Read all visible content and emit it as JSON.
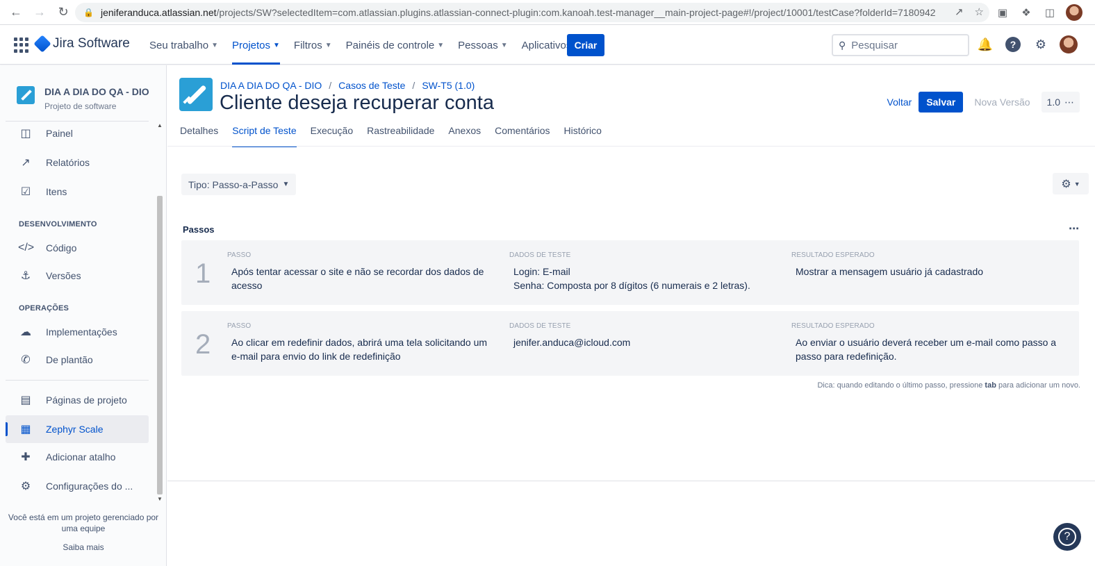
{
  "browser": {
    "url_host": "jeniferanduca.atlassian.net",
    "url_path": "/projects/SW?selectedItem=com.atlassian.plugins.atlassian-connect-plugin:com.kanoah.test-manager__main-project-page#!/project/10001/testCase?folderId=7180942"
  },
  "topnav": {
    "brand": "Jira Software",
    "menu": [
      "Seu trabalho",
      "Projetos",
      "Filtros",
      "Painéis de controle",
      "Pessoas",
      "Aplicativos"
    ],
    "create_label": "Criar",
    "search_placeholder": "Pesquisar"
  },
  "sidebar": {
    "project_name": "DIA A DIA DO QA - DIO",
    "project_type": "Projeto de software",
    "items": [
      "Painel",
      "Relatórios",
      "Itens"
    ],
    "section_dev": "DESENVOLVIMENTO",
    "dev_items": [
      "Código",
      "Versões"
    ],
    "section_ops": "OPERAÇÕES",
    "ops_items": [
      "Implementações",
      "De plantão"
    ],
    "bottom_items": [
      "Páginas de projeto",
      "Zephyr Scale",
      "Adicionar atalho",
      "Configurações do ..."
    ],
    "footer_text": "Você está em um projeto gerenciado por uma equipe",
    "footer_link": "Saiba mais"
  },
  "main": {
    "breadcrumbs": [
      "DIA A DIA DO QA - DIO",
      "Casos de Teste",
      "SW-T5 (1.0)"
    ],
    "title": "Cliente deseja recuperar conta",
    "actions": {
      "back": "Voltar",
      "save": "Salvar",
      "new_version": "Nova Versão",
      "version": "1.0"
    },
    "tabs": [
      "Detalhes",
      "Script de Teste",
      "Execução",
      "Rastreabilidade",
      "Anexos",
      "Comentários",
      "Histórico"
    ],
    "type_select": "Tipo: Passo-a-Passo",
    "steps_title": "Passos",
    "col_labels": {
      "step": "PASSO",
      "data": "DADOS DE TESTE",
      "expected": "RESULTADO ESPERADO"
    },
    "steps": [
      {
        "num": "1",
        "step": "Após tentar acessar o site e não se recordar dos dados de acesso",
        "data": "Login: E-mail\nSenha: Composta por 8 dígitos (6 numerais e 2 letras).",
        "expected": "Mostrar a mensagem usuário já cadastrado"
      },
      {
        "num": "2",
        "step": "Ao clicar em redefinir dados, abrirá uma tela solicitando um e-mail para envio do link de redefinição",
        "data": "jenifer.anduca@icloud.com",
        "expected": "Ao enviar o usuário deverá receber um e-mail como passo a passo para redefinição."
      }
    ],
    "tip_prefix": "Dica: quando editando o último passo, pressione ",
    "tip_key": "tab",
    "tip_suffix": " para adicionar um novo."
  },
  "colors": {
    "primary": "#0052cc",
    "text": "#172b4d",
    "subtle": "#42526e",
    "step_bg": "#f4f5f7"
  }
}
